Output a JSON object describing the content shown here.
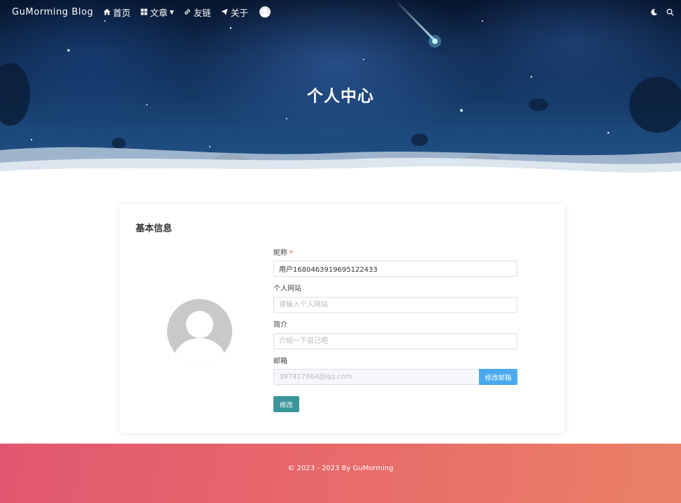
{
  "nav": {
    "brand": "GuMorming Blog",
    "items": [
      {
        "label": "首页",
        "icon": "home-icon"
      },
      {
        "label": "文章",
        "icon": "grid-icon"
      },
      {
        "label": "友链",
        "icon": "link-icon"
      },
      {
        "label": "关于",
        "icon": "send-icon"
      }
    ],
    "right_icons": [
      "moon-icon",
      "search-icon"
    ]
  },
  "hero": {
    "title": "个人中心"
  },
  "profile": {
    "section_title": "基本信息",
    "fields": {
      "nickname": {
        "label": "昵称",
        "required_mark": "*",
        "value": "用户1680463919695122433"
      },
      "website": {
        "label": "个人网站",
        "placeholder": "请输入个人网站"
      },
      "bio": {
        "label": "简介",
        "placeholder": "介绍一下自己吧"
      },
      "email": {
        "label": "邮箱",
        "value": "397417664@qq.com",
        "button": "修改邮箱"
      }
    },
    "submit": "修改"
  },
  "footer": {
    "text": "© 2023 - 2023 By GuMorming"
  },
  "colors": {
    "email_button": "#4aa9f0",
    "submit_button": "#3a969c",
    "footer_gradient_start": "#e1566f",
    "footer_gradient_end": "#ea8166"
  }
}
